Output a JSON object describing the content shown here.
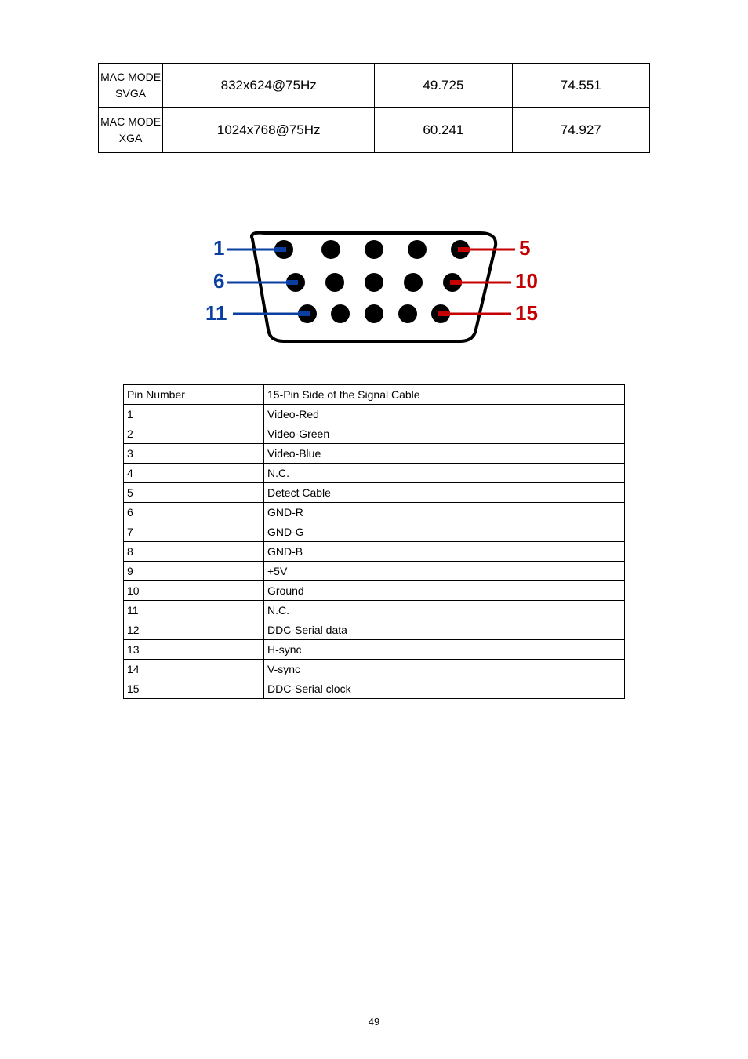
{
  "modes": [
    {
      "mode": "MAC MODE\nSVGA",
      "resolution": "832x624@75Hz",
      "h": "49.725",
      "v": "74.551"
    },
    {
      "mode": "MAC MODE\nXGA",
      "resolution": "1024x768@75Hz",
      "h": "60.241",
      "v": "74.927"
    }
  ],
  "connector": {
    "labels": {
      "l1": "1",
      "l2": "6",
      "l3": "11",
      "r1": "5",
      "r2": "10",
      "r3": "15"
    }
  },
  "pin_header": {
    "c1": "Pin Number",
    "c2": "15-Pin Side of the Signal Cable"
  },
  "pins": [
    {
      "n": "1",
      "d": "Video-Red"
    },
    {
      "n": "2",
      "d": "Video-Green"
    },
    {
      "n": "3",
      "d": "Video-Blue"
    },
    {
      "n": "4",
      "d": "N.C."
    },
    {
      "n": "5",
      "d": "Detect Cable"
    },
    {
      "n": "6",
      "d": "GND-R"
    },
    {
      "n": "7",
      "d": "GND-G"
    },
    {
      "n": "8",
      "d": "GND-B"
    },
    {
      "n": "9",
      "d": "+5V"
    },
    {
      "n": "10",
      "d": "Ground"
    },
    {
      "n": "11",
      "d": "N.C."
    },
    {
      "n": "12",
      "d": "DDC-Serial data"
    },
    {
      "n": "13",
      "d": "H-sync"
    },
    {
      "n": "14",
      "d": "V-sync"
    },
    {
      "n": "15",
      "d": "DDC-Serial clock"
    }
  ],
  "page_number": "49"
}
